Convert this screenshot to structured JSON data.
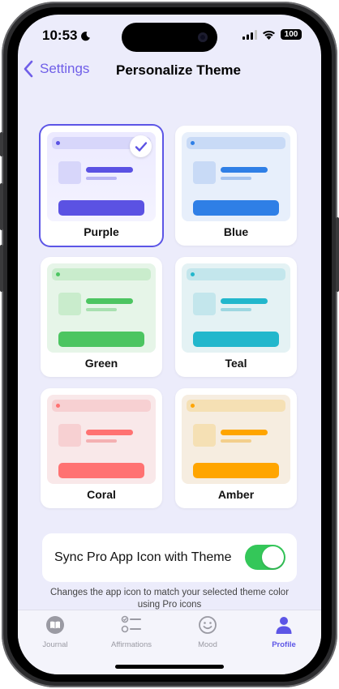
{
  "status": {
    "time": "10:53",
    "battery": "100"
  },
  "nav": {
    "back_label": "Settings",
    "title": "Personalize Theme"
  },
  "themes": [
    {
      "name": "Purple",
      "selected": true,
      "accent": "#5b52e3",
      "light": "#d7d6fa",
      "bg": "#eceaff",
      "line": "#b9b5f5"
    },
    {
      "name": "Blue",
      "selected": false,
      "accent": "#2f7fe6",
      "light": "#c8daf6",
      "bg": "#e7effb",
      "line": "#a6c4ef"
    },
    {
      "name": "Green",
      "selected": false,
      "accent": "#4cc561",
      "light": "#c9eccc",
      "bg": "#e6f5e8",
      "line": "#a8e0b0"
    },
    {
      "name": "Teal",
      "selected": false,
      "accent": "#22b7cc",
      "light": "#c3e6ec",
      "bg": "#e4f2f4",
      "line": "#9dd7e1"
    },
    {
      "name": "Coral",
      "selected": false,
      "accent": "#ff7272",
      "light": "#f7d0d2",
      "bg": "#f9e8e9",
      "line": "#f4b0b2"
    },
    {
      "name": "Amber",
      "selected": false,
      "accent": "#ffa500",
      "light": "#f5e0b4",
      "bg": "#f6ede0",
      "line": "#f3cf8c"
    }
  ],
  "sync": {
    "label": "Sync Pro App Icon with Theme",
    "enabled": true,
    "note": "Changes the app icon to match your selected theme color using Pro icons"
  },
  "tabs": [
    {
      "label": "Journal",
      "icon": "book-icon",
      "active": false
    },
    {
      "label": "Affirmations",
      "icon": "checklist-icon",
      "active": false
    },
    {
      "label": "Mood",
      "icon": "smiley-icon",
      "active": false
    },
    {
      "label": "Profile",
      "icon": "person-icon",
      "active": true
    }
  ],
  "colors": {
    "accent": "#5c55e6",
    "toggle_on": "#34c759",
    "background": "#ececfb"
  }
}
